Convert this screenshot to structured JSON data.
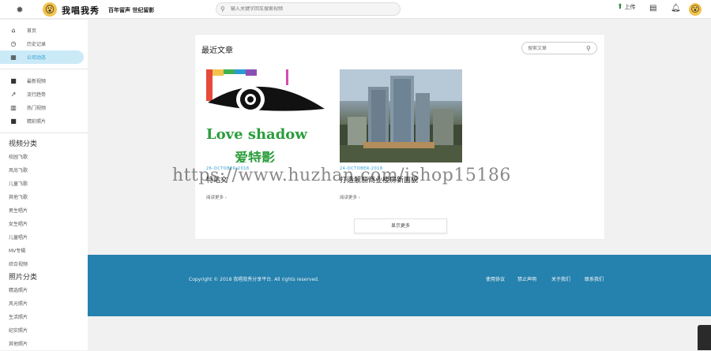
{
  "header": {
    "brand": "我唱我秀",
    "slogan": "百年留声 世纪留影",
    "search_placeholder": "输入关键字回车搜索视频",
    "upload_label": "上传",
    "icons": [
      "bulb-icon",
      "logo-emoji-icon",
      "search-icon",
      "upload-icon",
      "message-icon",
      "bell-icon",
      "avatar-icon"
    ]
  },
  "sidebar": {
    "main": [
      {
        "label": "首页",
        "icon": "home-icon"
      },
      {
        "label": "历史记录",
        "icon": "history-icon"
      },
      {
        "label": "公司动态",
        "icon": "news-icon",
        "active": true
      }
    ],
    "secondary": [
      {
        "label": "最新视频",
        "icon": "video-icon"
      },
      {
        "label": "流行趋势",
        "icon": "trend-icon"
      },
      {
        "label": "热门视频",
        "icon": "chart-icon"
      },
      {
        "label": "精彩照片",
        "icon": "photo-icon"
      }
    ],
    "video_category_title": "视频分类",
    "video_categories": [
      "校园飞歌",
      "风尚飞歌",
      "儿童飞歌",
      "其他飞歌",
      "男生唱片",
      "女生唱片",
      "儿童唱片",
      "MV专辑",
      "综合视频"
    ],
    "photo_category_title": "照片分类",
    "photo_categories": [
      "精选照片",
      "风光照片",
      "生活照片",
      "纪实照片",
      "其他照片"
    ]
  },
  "main": {
    "title": "最近文章",
    "search_placeholder": "搜索文章",
    "posts": [
      {
        "date": "26-OCTOBER-2018",
        "title": "特站文",
        "more": "阅读更多 ›",
        "image_text": "Love shadow",
        "image_subtext": "爱特影"
      },
      {
        "date": "24-OCTOBER-2018",
        "title": "打造靓丽商业楼房新面貌",
        "more": "阅读更多 ›"
      }
    ],
    "load_more": "显示更多"
  },
  "footer": {
    "copyright": "Copyright © 2018 我唱我秀分享平台. All rights reserved.",
    "links": [
      "使用协议",
      "禁止声明",
      "关于我们",
      "联系我们"
    ]
  },
  "watermark": "https://www.huzhan.com/ishop15186",
  "colors": {
    "accent": "#2a9bd3",
    "footer": "#2581ad",
    "active_bg": "#cbeaf7"
  }
}
